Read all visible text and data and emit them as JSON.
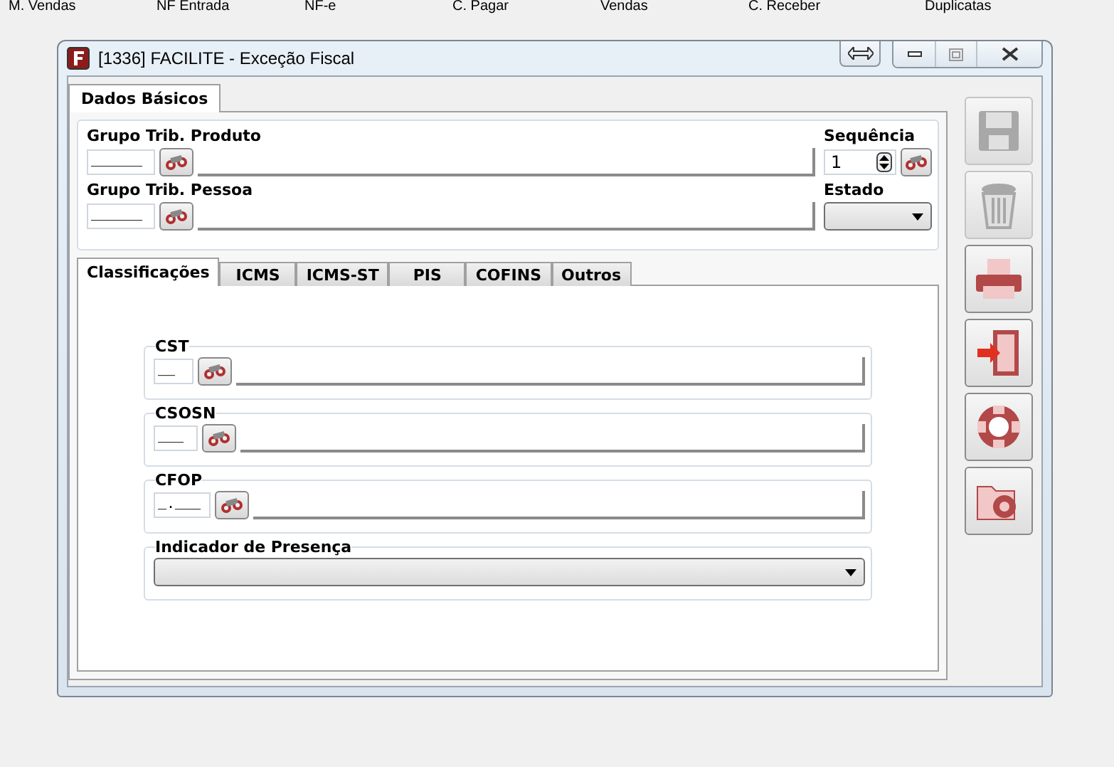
{
  "menu": [
    "M. Vendas",
    "NF Entrada",
    "NF-e",
    "C. Pagar",
    "Vendas",
    "C. Receber",
    "Duplicatas"
  ],
  "window": {
    "title": "[1336] FACILITE - Exceção Fiscal"
  },
  "top_tabs": [
    {
      "label": "Dados Básicos",
      "selected": true
    }
  ],
  "header_fields": [
    {
      "label": "Grupo Trib. Produto",
      "code": "______"
    },
    {
      "label": "Grupo Trib. Pessoa",
      "code": "______"
    }
  ],
  "sequencia": {
    "label": "Sequência",
    "value": "1"
  },
  "estado": {
    "label": "Estado"
  },
  "tabs": [
    {
      "label": "Classificações",
      "selected": true
    },
    {
      "label": "ICMS",
      "selected": false
    },
    {
      "label": "ICMS-ST",
      "selected": false
    },
    {
      "label": "PIS",
      "selected": false
    },
    {
      "label": "COFINS",
      "selected": false
    },
    {
      "label": "Outros",
      "selected": false
    }
  ],
  "groups": [
    {
      "kind": "lookup",
      "label": "CST",
      "code": "__"
    },
    {
      "kind": "lookup",
      "label": "CSOSN",
      "code": "___"
    },
    {
      "kind": "lookup",
      "label": "CFOP",
      "code": "_.___"
    },
    {
      "kind": "select",
      "label": "Indicador de Presença"
    }
  ],
  "toolbar": [
    {
      "kind": "save",
      "disabled": true
    },
    {
      "kind": "delete",
      "disabled": true
    },
    {
      "kind": "print",
      "disabled": false
    },
    {
      "kind": "exit",
      "disabled": false
    },
    {
      "kind": "help",
      "disabled": false
    },
    {
      "kind": "settings",
      "disabled": false
    }
  ]
}
